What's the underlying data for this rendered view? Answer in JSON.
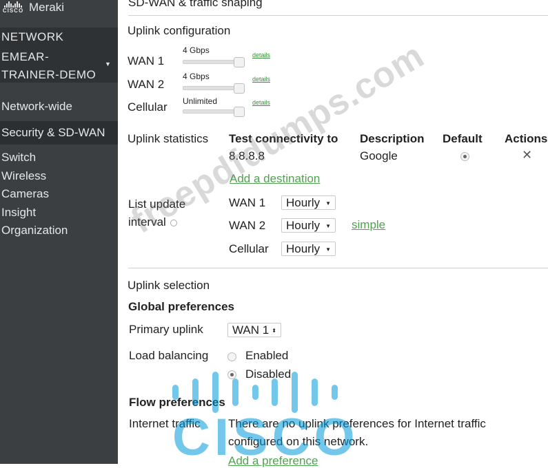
{
  "app": {
    "logo_text": "CISCO",
    "brand": "Meraki"
  },
  "sidebar": {
    "network_label": "NETWORK",
    "network_name": "EMEAR-TRAINER-DEMO",
    "items": [
      {
        "label": "Network-wide"
      },
      {
        "label": "Security & SD-WAN",
        "active": true
      },
      {
        "label": "Switch"
      },
      {
        "label": "Wireless"
      },
      {
        "label": "Cameras"
      },
      {
        "label": "Insight"
      },
      {
        "label": "Organization"
      }
    ]
  },
  "page": {
    "title": "SD-WAN & traffic shaping"
  },
  "uplink_config": {
    "heading": "Uplink configuration",
    "rows": [
      {
        "name": "WAN 1",
        "limit": "4 Gbps",
        "details": "details"
      },
      {
        "name": "WAN 2",
        "limit": "4 Gbps",
        "details": "details"
      },
      {
        "name": "Cellular",
        "limit": "Unlimited",
        "details": "details"
      }
    ]
  },
  "uplink_stats": {
    "heading": "Uplink statistics",
    "columns": [
      "Test connectivity to",
      "Description",
      "Default",
      "Actions"
    ],
    "rows": [
      {
        "target": "8.8.8.8",
        "description": "Google",
        "default": true
      }
    ],
    "add_destination": "Add a destination",
    "interval_label": "List update interval",
    "intervals": [
      {
        "name": "WAN 1",
        "value": "Hourly"
      },
      {
        "name": "WAN 2",
        "value": "Hourly"
      },
      {
        "name": "Cellular",
        "value": "Hourly"
      }
    ],
    "simple_link": "simple"
  },
  "uplink_selection": {
    "heading": "Uplink selection",
    "global_heading": "Global preferences",
    "primary_label": "Primary uplink",
    "primary_value": "WAN 1",
    "lb_label": "Load balancing",
    "lb_options": [
      {
        "label": "Enabled",
        "selected": false
      },
      {
        "label": "Disabled",
        "selected": true
      }
    ],
    "flow_heading": "Flow preferences",
    "internet_label": "Internet traffic",
    "internet_text_1": "There are no uplink preferences for Internet traffic",
    "internet_text_2": "configured on this network.",
    "add_preference": "Add a preference"
  },
  "watermark": {
    "site": "freepdfdumps.com",
    "logo_word": "CISCO"
  }
}
